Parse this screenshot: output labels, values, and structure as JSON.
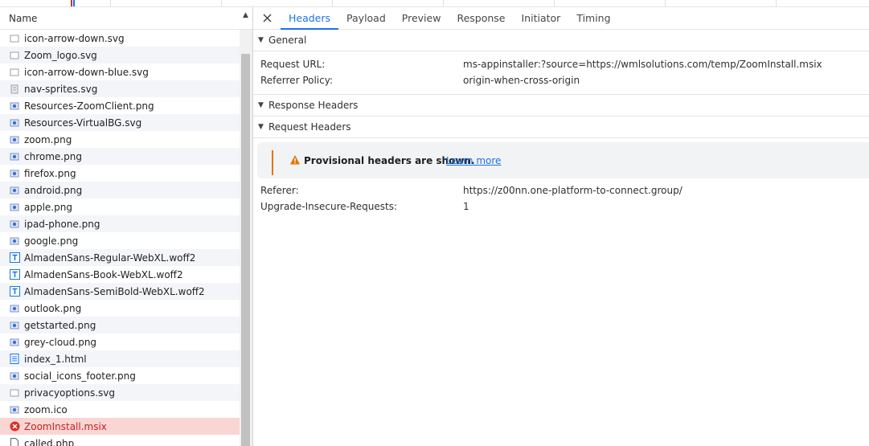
{
  "list": {
    "column_name": "Name",
    "sort_indicator": "▲",
    "rows": [
      {
        "name": "icon-arrow-down.svg",
        "icon": "svg-file-icon"
      },
      {
        "name": "Zoom_logo.svg",
        "icon": "svg-file-icon"
      },
      {
        "name": "icon-arrow-down-blue.svg",
        "icon": "svg-file-icon"
      },
      {
        "name": "nav-sprites.svg",
        "icon": "sprite-file-icon"
      },
      {
        "name": "Resources-ZoomClient.png",
        "icon": "image-file-icon"
      },
      {
        "name": "Resources-VirtualBG.svg",
        "icon": "image-file-icon"
      },
      {
        "name": "zoom.png",
        "icon": "image-file-icon"
      },
      {
        "name": "chrome.png",
        "icon": "image-file-icon"
      },
      {
        "name": "firefox.png",
        "icon": "image-file-icon"
      },
      {
        "name": "android.png",
        "icon": "image-file-icon"
      },
      {
        "name": "apple.png",
        "icon": "image-file-icon"
      },
      {
        "name": "ipad-phone.png",
        "icon": "image-file-icon"
      },
      {
        "name": "google.png",
        "icon": "image-file-icon"
      },
      {
        "name": "AlmadenSans-Regular-WebXL.woff2",
        "icon": "font-file-icon"
      },
      {
        "name": "AlmadenSans-Book-WebXL.woff2",
        "icon": "font-file-icon"
      },
      {
        "name": "AlmadenSans-SemiBold-WebXL.woff2",
        "icon": "font-file-icon"
      },
      {
        "name": "outlook.png",
        "icon": "image-file-icon"
      },
      {
        "name": "getstarted.png",
        "icon": "image-file-icon"
      },
      {
        "name": "grey-cloud.png",
        "icon": "image-file-icon"
      },
      {
        "name": "index_1.html",
        "icon": "document-file-icon"
      },
      {
        "name": "social_icons_footer.png",
        "icon": "image-file-icon"
      },
      {
        "name": "privacyoptions.svg",
        "icon": "svg-file-icon"
      },
      {
        "name": "zoom.ico",
        "icon": "image-file-icon"
      },
      {
        "name": "ZoomInstall.msix",
        "icon": "error-icon",
        "error": true
      },
      {
        "name": "called.php",
        "icon": "generic-file-icon"
      }
    ]
  },
  "detail": {
    "tabs": [
      "Headers",
      "Payload",
      "Preview",
      "Response",
      "Initiator",
      "Timing"
    ],
    "active_tab": "Headers",
    "general": {
      "title": "General",
      "request_url_label": "Request URL:",
      "request_url_value": "ms-appinstaller:?source=https://wmlsolutions.com/temp/ZoomInstall.msix",
      "referrer_policy_label": "Referrer Policy:",
      "referrer_policy_value": "origin-when-cross-origin"
    },
    "response_headers_title": "Response Headers",
    "request_headers": {
      "title": "Request Headers",
      "warning_text": "Provisional headers are shown.",
      "learn_more": "Learn more",
      "referer_label": "Referer:",
      "referer_value": "https://z00nn.one-platform-to-connect.group/",
      "upgrade_label": "Upgrade-Insecure-Requests:",
      "upgrade_value": "1"
    }
  },
  "colors": {
    "accent": "#1a73e8",
    "error_row_bg": "#f9d6d3",
    "error_text": "#c5221f",
    "warning": "#e37400"
  }
}
